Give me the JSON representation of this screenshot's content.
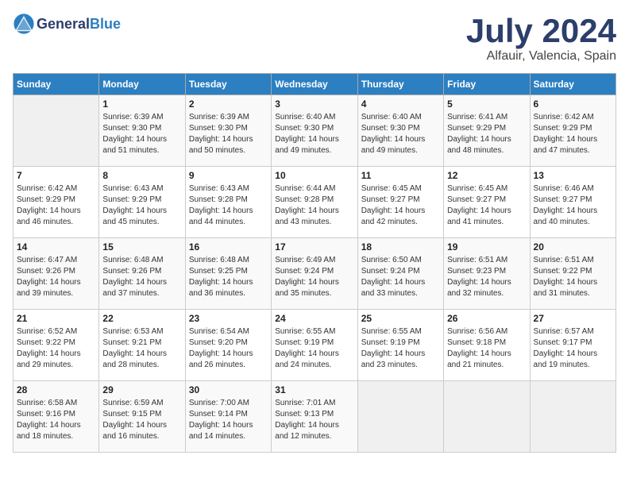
{
  "header": {
    "logo_general": "General",
    "logo_blue": "Blue",
    "month_title": "July 2024",
    "location": "Alfauir, Valencia, Spain"
  },
  "weekdays": [
    "Sunday",
    "Monday",
    "Tuesday",
    "Wednesday",
    "Thursday",
    "Friday",
    "Saturday"
  ],
  "weeks": [
    [
      {
        "day": "",
        "sunrise": "",
        "sunset": "",
        "daylight": ""
      },
      {
        "day": "1",
        "sunrise": "Sunrise: 6:39 AM",
        "sunset": "Sunset: 9:30 PM",
        "daylight": "Daylight: 14 hours and 51 minutes."
      },
      {
        "day": "2",
        "sunrise": "Sunrise: 6:39 AM",
        "sunset": "Sunset: 9:30 PM",
        "daylight": "Daylight: 14 hours and 50 minutes."
      },
      {
        "day": "3",
        "sunrise": "Sunrise: 6:40 AM",
        "sunset": "Sunset: 9:30 PM",
        "daylight": "Daylight: 14 hours and 49 minutes."
      },
      {
        "day": "4",
        "sunrise": "Sunrise: 6:40 AM",
        "sunset": "Sunset: 9:30 PM",
        "daylight": "Daylight: 14 hours and 49 minutes."
      },
      {
        "day": "5",
        "sunrise": "Sunrise: 6:41 AM",
        "sunset": "Sunset: 9:29 PM",
        "daylight": "Daylight: 14 hours and 48 minutes."
      },
      {
        "day": "6",
        "sunrise": "Sunrise: 6:42 AM",
        "sunset": "Sunset: 9:29 PM",
        "daylight": "Daylight: 14 hours and 47 minutes."
      }
    ],
    [
      {
        "day": "7",
        "sunrise": "Sunrise: 6:42 AM",
        "sunset": "Sunset: 9:29 PM",
        "daylight": "Daylight: 14 hours and 46 minutes."
      },
      {
        "day": "8",
        "sunrise": "Sunrise: 6:43 AM",
        "sunset": "Sunset: 9:29 PM",
        "daylight": "Daylight: 14 hours and 45 minutes."
      },
      {
        "day": "9",
        "sunrise": "Sunrise: 6:43 AM",
        "sunset": "Sunset: 9:28 PM",
        "daylight": "Daylight: 14 hours and 44 minutes."
      },
      {
        "day": "10",
        "sunrise": "Sunrise: 6:44 AM",
        "sunset": "Sunset: 9:28 PM",
        "daylight": "Daylight: 14 hours and 43 minutes."
      },
      {
        "day": "11",
        "sunrise": "Sunrise: 6:45 AM",
        "sunset": "Sunset: 9:27 PM",
        "daylight": "Daylight: 14 hours and 42 minutes."
      },
      {
        "day": "12",
        "sunrise": "Sunrise: 6:45 AM",
        "sunset": "Sunset: 9:27 PM",
        "daylight": "Daylight: 14 hours and 41 minutes."
      },
      {
        "day": "13",
        "sunrise": "Sunrise: 6:46 AM",
        "sunset": "Sunset: 9:27 PM",
        "daylight": "Daylight: 14 hours and 40 minutes."
      }
    ],
    [
      {
        "day": "14",
        "sunrise": "Sunrise: 6:47 AM",
        "sunset": "Sunset: 9:26 PM",
        "daylight": "Daylight: 14 hours and 39 minutes."
      },
      {
        "day": "15",
        "sunrise": "Sunrise: 6:48 AM",
        "sunset": "Sunset: 9:26 PM",
        "daylight": "Daylight: 14 hours and 37 minutes."
      },
      {
        "day": "16",
        "sunrise": "Sunrise: 6:48 AM",
        "sunset": "Sunset: 9:25 PM",
        "daylight": "Daylight: 14 hours and 36 minutes."
      },
      {
        "day": "17",
        "sunrise": "Sunrise: 6:49 AM",
        "sunset": "Sunset: 9:24 PM",
        "daylight": "Daylight: 14 hours and 35 minutes."
      },
      {
        "day": "18",
        "sunrise": "Sunrise: 6:50 AM",
        "sunset": "Sunset: 9:24 PM",
        "daylight": "Daylight: 14 hours and 33 minutes."
      },
      {
        "day": "19",
        "sunrise": "Sunrise: 6:51 AM",
        "sunset": "Sunset: 9:23 PM",
        "daylight": "Daylight: 14 hours and 32 minutes."
      },
      {
        "day": "20",
        "sunrise": "Sunrise: 6:51 AM",
        "sunset": "Sunset: 9:22 PM",
        "daylight": "Daylight: 14 hours and 31 minutes."
      }
    ],
    [
      {
        "day": "21",
        "sunrise": "Sunrise: 6:52 AM",
        "sunset": "Sunset: 9:22 PM",
        "daylight": "Daylight: 14 hours and 29 minutes."
      },
      {
        "day": "22",
        "sunrise": "Sunrise: 6:53 AM",
        "sunset": "Sunset: 9:21 PM",
        "daylight": "Daylight: 14 hours and 28 minutes."
      },
      {
        "day": "23",
        "sunrise": "Sunrise: 6:54 AM",
        "sunset": "Sunset: 9:20 PM",
        "daylight": "Daylight: 14 hours and 26 minutes."
      },
      {
        "day": "24",
        "sunrise": "Sunrise: 6:55 AM",
        "sunset": "Sunset: 9:19 PM",
        "daylight": "Daylight: 14 hours and 24 minutes."
      },
      {
        "day": "25",
        "sunrise": "Sunrise: 6:55 AM",
        "sunset": "Sunset: 9:19 PM",
        "daylight": "Daylight: 14 hours and 23 minutes."
      },
      {
        "day": "26",
        "sunrise": "Sunrise: 6:56 AM",
        "sunset": "Sunset: 9:18 PM",
        "daylight": "Daylight: 14 hours and 21 minutes."
      },
      {
        "day": "27",
        "sunrise": "Sunrise: 6:57 AM",
        "sunset": "Sunset: 9:17 PM",
        "daylight": "Daylight: 14 hours and 19 minutes."
      }
    ],
    [
      {
        "day": "28",
        "sunrise": "Sunrise: 6:58 AM",
        "sunset": "Sunset: 9:16 PM",
        "daylight": "Daylight: 14 hours and 18 minutes."
      },
      {
        "day": "29",
        "sunrise": "Sunrise: 6:59 AM",
        "sunset": "Sunset: 9:15 PM",
        "daylight": "Daylight: 14 hours and 16 minutes."
      },
      {
        "day": "30",
        "sunrise": "Sunrise: 7:00 AM",
        "sunset": "Sunset: 9:14 PM",
        "daylight": "Daylight: 14 hours and 14 minutes."
      },
      {
        "day": "31",
        "sunrise": "Sunrise: 7:01 AM",
        "sunset": "Sunset: 9:13 PM",
        "daylight": "Daylight: 14 hours and 12 minutes."
      },
      {
        "day": "",
        "sunrise": "",
        "sunset": "",
        "daylight": ""
      },
      {
        "day": "",
        "sunrise": "",
        "sunset": "",
        "daylight": ""
      },
      {
        "day": "",
        "sunrise": "",
        "sunset": "",
        "daylight": ""
      }
    ]
  ]
}
